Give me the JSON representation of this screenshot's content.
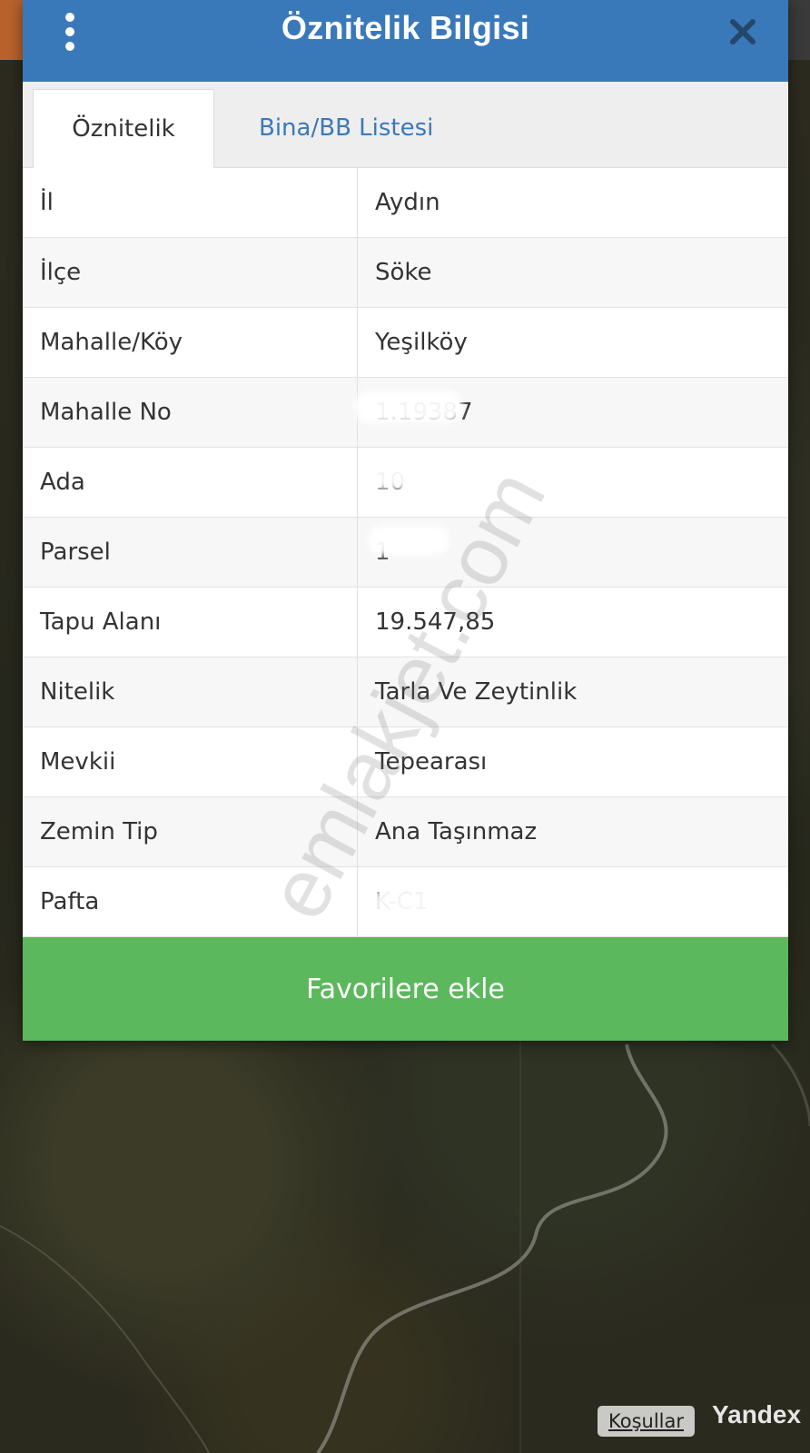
{
  "dialog": {
    "title": "Öznitelik Bilgisi",
    "header_color": "#3a79b9"
  },
  "tabs": [
    {
      "label": "Öznitelik Bilgisi",
      "active": true
    },
    {
      "label": "Bina/BB Listesi",
      "active": false
    }
  ],
  "attributes": [
    {
      "key": "İl",
      "value": "Aydın"
    },
    {
      "key": "İlçe",
      "value": "Söke"
    },
    {
      "key": "Mahalle/Köy",
      "value": "Yeşilköy"
    },
    {
      "key": "Mahalle No",
      "value": "1.19387"
    },
    {
      "key": "Ada",
      "value": "10"
    },
    {
      "key": "Parsel",
      "value": "1"
    },
    {
      "key": "Tapu Alanı",
      "value": "19.547,85"
    },
    {
      "key": "Nitelik",
      "value": "Tarla Ve Zeytinlik"
    },
    {
      "key": "Mevkii",
      "value": "Tepearası"
    },
    {
      "key": "Zemin Tip",
      "value": "Ana Taşınmaz"
    },
    {
      "key": "Pafta",
      "value": "K-C1"
    }
  ],
  "favorite_button": {
    "label": "Favorilere ekle",
    "color": "#5cb85c"
  },
  "watermark": "emlakjet.com",
  "map": {
    "terms_link": "Koşullar",
    "provider": "Yandex"
  }
}
